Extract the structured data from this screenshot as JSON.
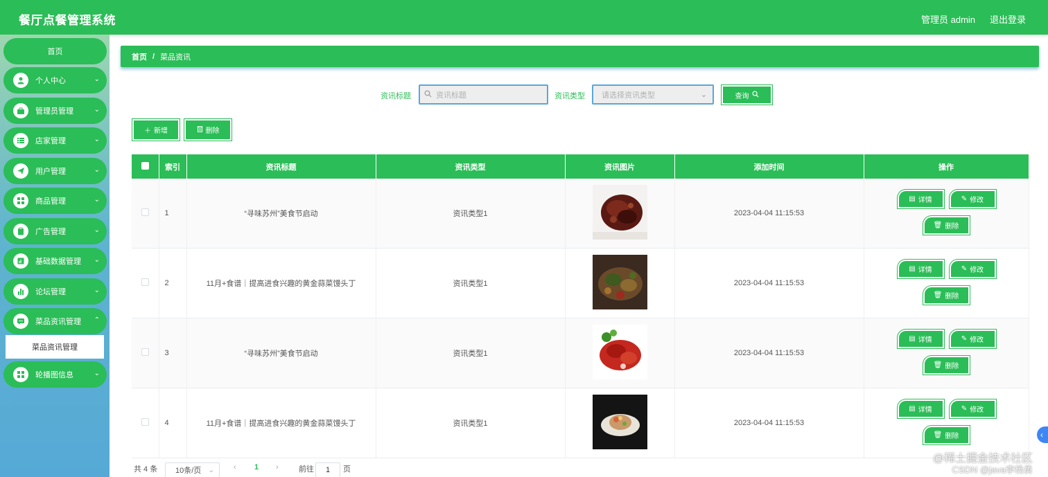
{
  "header": {
    "title": "餐厅点餐管理系统",
    "user": "管理员 admin",
    "logout": "退出登录"
  },
  "sidebar": {
    "home": "首页",
    "items": [
      {
        "label": "个人中心",
        "icon": "person-icon"
      },
      {
        "label": "管理员管理",
        "icon": "briefcase-icon"
      },
      {
        "label": "店家管理",
        "icon": "list-icon"
      },
      {
        "label": "用户管理",
        "icon": "send-icon"
      },
      {
        "label": "商品管理",
        "icon": "grid-icon"
      },
      {
        "label": "广告管理",
        "icon": "clipboard-icon"
      },
      {
        "label": "基础数据管理",
        "icon": "chart-icon"
      },
      {
        "label": "论坛管理",
        "icon": "bar-chart-icon"
      },
      {
        "label": "菜品资讯管理",
        "icon": "chat-icon"
      },
      {
        "label": "轮播图信息",
        "icon": "grid-icon"
      }
    ],
    "active_sub": "菜品资讯管理"
  },
  "breadcrumb": {
    "home": "首页",
    "sep": "/",
    "current": "菜品资讯"
  },
  "search": {
    "title_label": "资讯标题",
    "title_placeholder": "资讯标题",
    "type_label": "资讯类型",
    "type_placeholder": "请选择资讯类型",
    "query_button": "查询"
  },
  "toolbar": {
    "add": "新增",
    "delete": "删除"
  },
  "table": {
    "headers": [
      "",
      "索引",
      "资讯标题",
      "资讯类型",
      "资讯图片",
      "添加时间",
      "操作"
    ],
    "rows": [
      {
        "index": "1",
        "title": "“寻味苏州”美食节启动",
        "type": "资讯类型1",
        "time": "2023-04-04 11:15:53"
      },
      {
        "index": "2",
        "title": "11月+食谱｜提高进食兴趣的黄金蒜菜馒头丁",
        "type": "资讯类型1",
        "time": "2023-04-04 11:15:53"
      },
      {
        "index": "3",
        "title": "“寻味苏州”美食节启动",
        "type": "资讯类型1",
        "time": "2023-04-04 11:15:53"
      },
      {
        "index": "4",
        "title": "11月+食谱｜提高进食兴趣的黄金蒜菜馒头丁",
        "type": "资讯类型1",
        "time": "2023-04-04 11:15:53"
      }
    ],
    "actions": {
      "detail": "详情",
      "edit": "修改",
      "delete": "删除"
    }
  },
  "pagination": {
    "total": "共 4 条",
    "page_size": "10条/页",
    "prev": "‹",
    "current": "1",
    "next": "›",
    "goto": "前往",
    "goto_value": "1",
    "page_unit": "页"
  },
  "watermark": {
    "line1": "@稀土掘金技术社区",
    "line2": "CSDN @java李杨勇"
  },
  "colors": {
    "primary": "#2bbd57",
    "input_border": "#5aa7d9",
    "float": "#3d86f5"
  }
}
